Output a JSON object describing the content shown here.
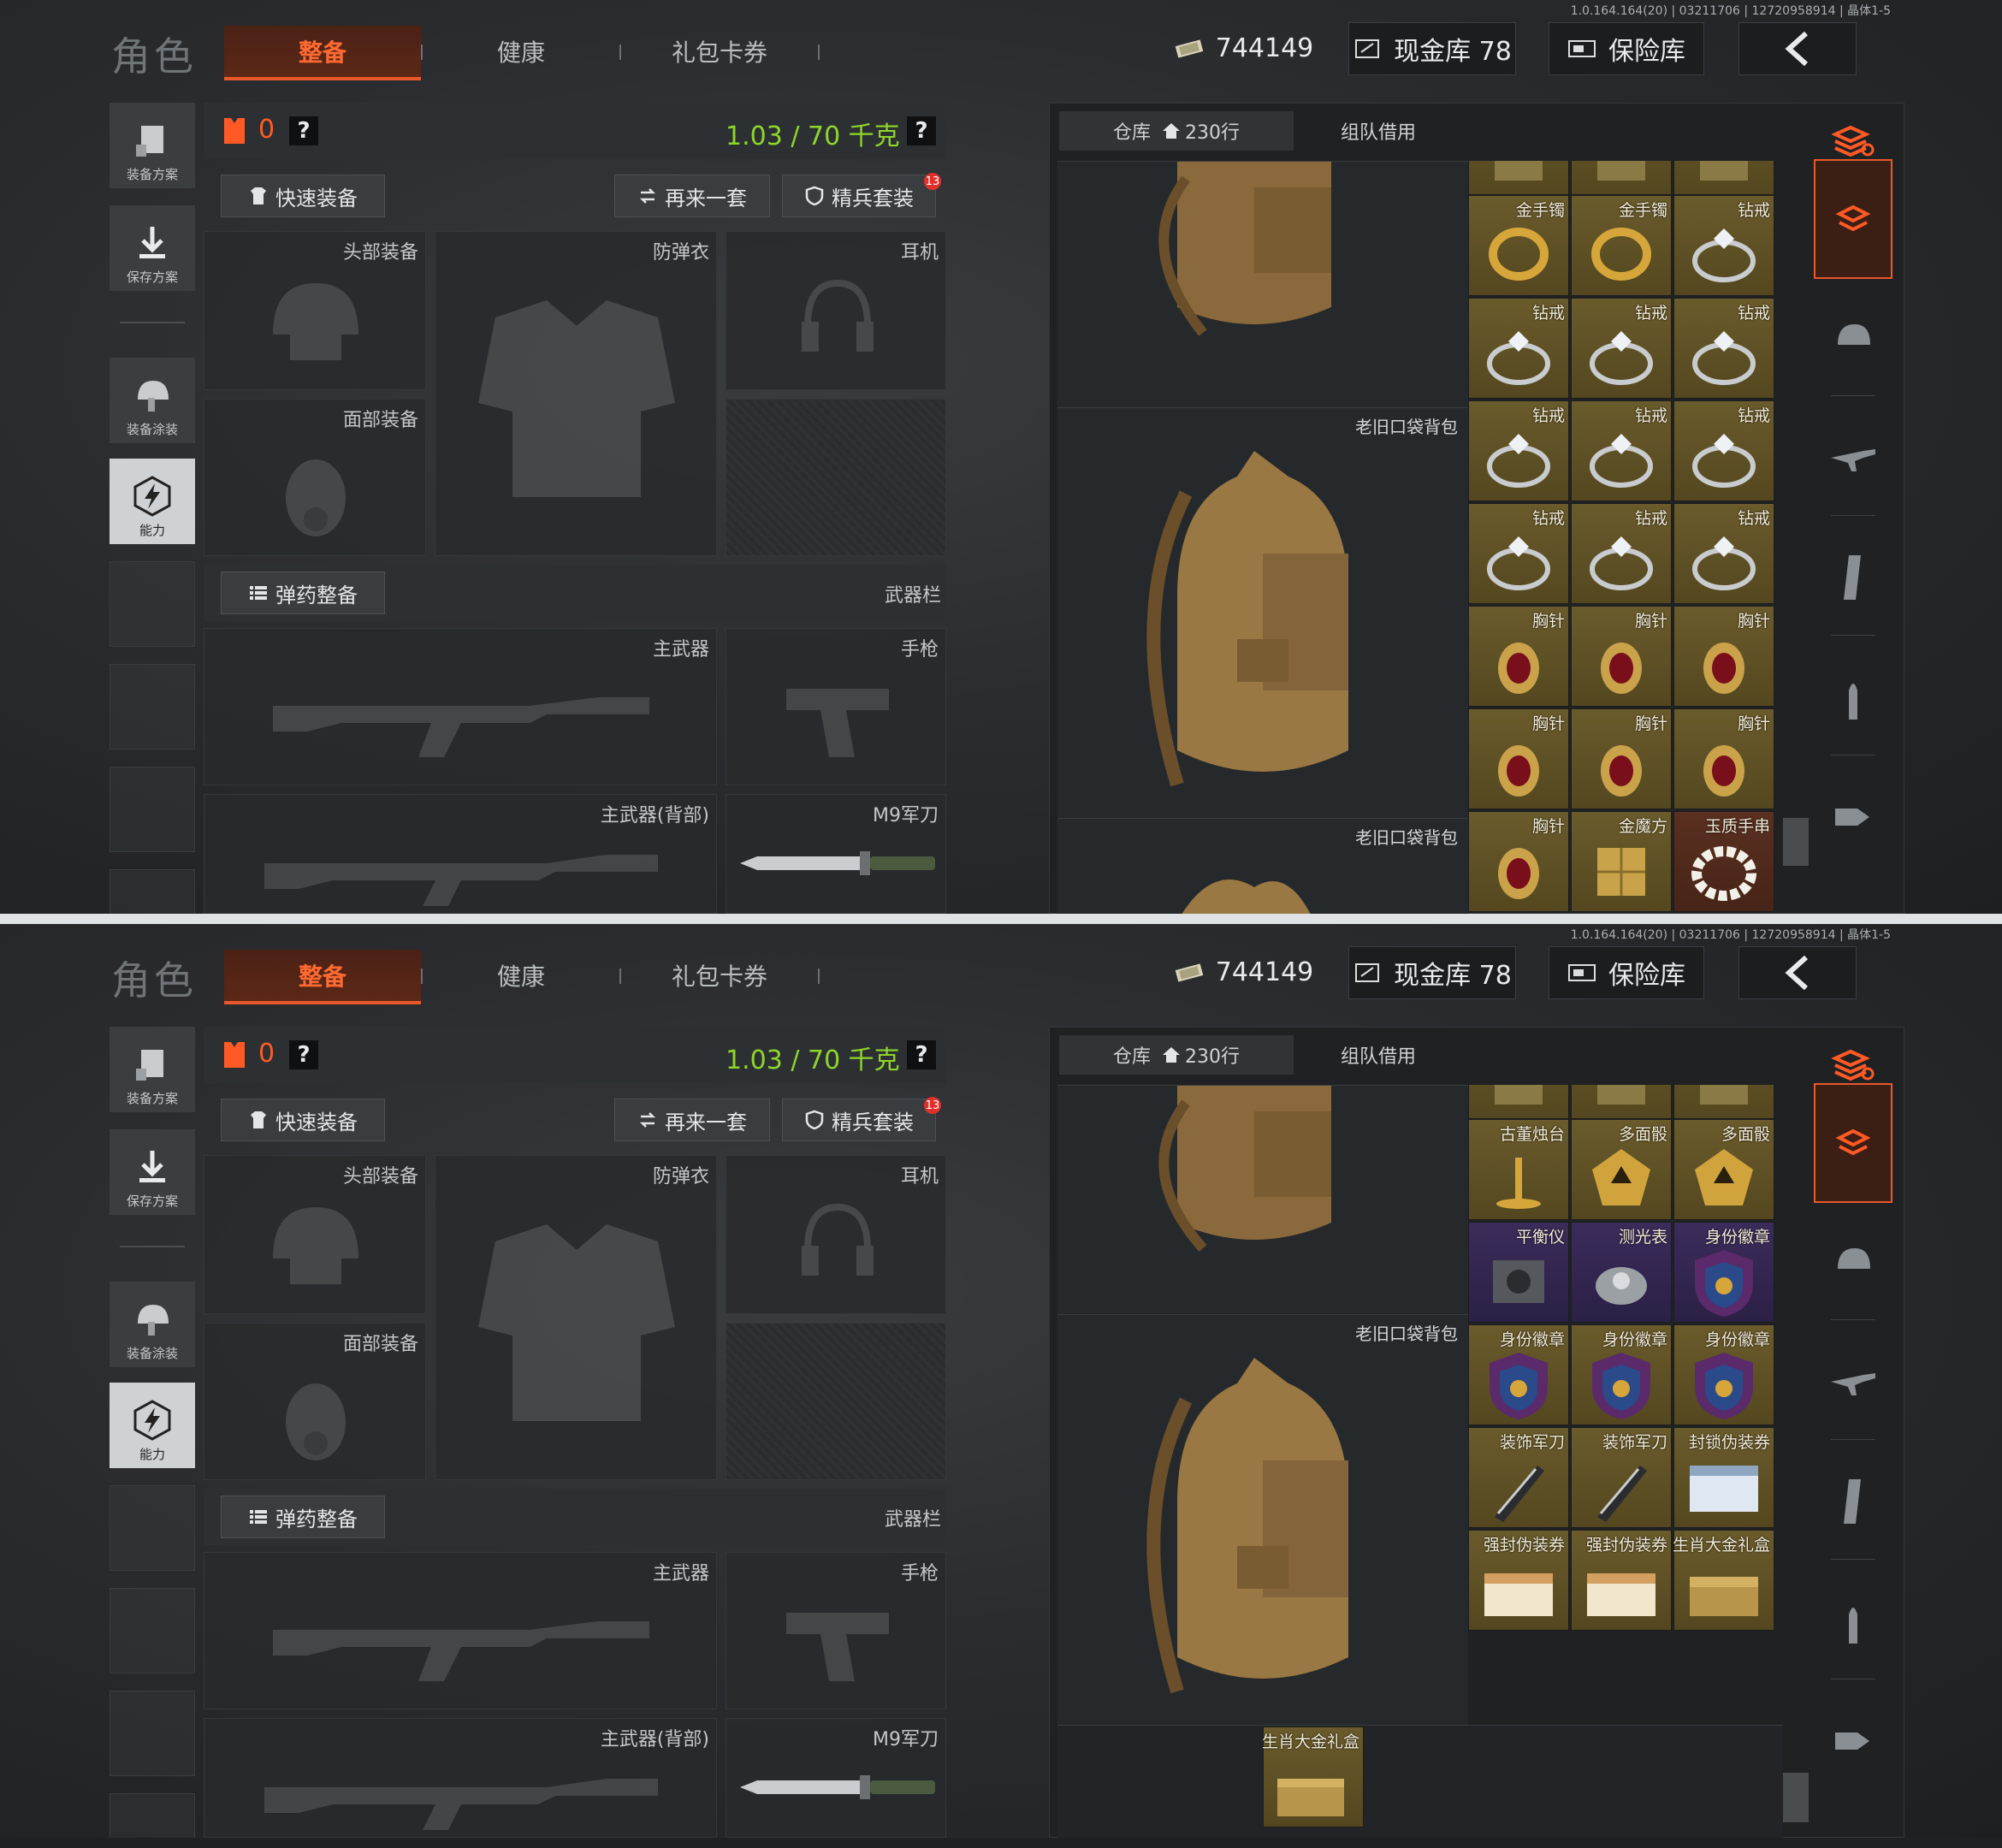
{
  "version": "1.0.164.164(20) | 03211706 | 12720958914 | 晶体1-5",
  "header": {
    "title": "角色",
    "tabs": [
      "整备",
      "健康",
      "礼包卡券"
    ],
    "money": "744149",
    "cash_vault": "现金库 78",
    "safe_box": "保险库"
  },
  "left_nav": {
    "plan": "装备方案",
    "save": "保存方案",
    "paint": "装备涂装",
    "ability": "能力"
  },
  "gear": {
    "armor_count": "0",
    "help": "?",
    "weight": "1.03 / 70 千克",
    "quick_equip": "快速装备",
    "again": "再来一套",
    "elite": "精兵套装",
    "elite_badge": "13",
    "slots": {
      "head": "头部装备",
      "armor": "防弹衣",
      "earphone": "耳机",
      "face": "面部装备",
      "ammo": "弹药整备",
      "weapon_bar": "武器栏",
      "primary": "主武器",
      "pistol": "手枪",
      "primary_back": "主武器(背部)",
      "knife": "M9军刀"
    }
  },
  "warehouse": {
    "tab_store": "仓库",
    "rows": "230行",
    "tab_team": "组队借用",
    "bag_label": "老旧口袋背包",
    "top_items": [
      [
        "",
        "",
        ""
      ],
      [
        "金手镯",
        "金手镯",
        "钻戒"
      ],
      [
        "钻戒",
        "钻戒",
        "钻戒"
      ],
      [
        "钻戒",
        "钻戒",
        "钻戒"
      ],
      [
        "钻戒",
        "钻戒",
        "钻戒"
      ],
      [
        "胸针",
        "胸针",
        "胸针"
      ],
      [
        "胸针",
        "胸针",
        "胸针"
      ],
      [
        "胸针",
        "金魔方",
        "玉质手串"
      ]
    ],
    "bottom_items": [
      [
        "",
        "",
        ""
      ],
      [
        "古董烛台",
        "多面骰",
        "多面骰"
      ],
      [
        "平衡仪",
        "测光表",
        "身份徽章"
      ],
      [
        "身份徽章",
        "身份徽章",
        "身份徽章"
      ],
      [
        "装饰军刀",
        "装饰军刀",
        "封锁伪装券"
      ],
      [
        "强封伪装券",
        "强封伪装券",
        "生肖大金礼盒"
      ]
    ],
    "bottom_extra": "生肖大金礼盒"
  },
  "colors": {
    "accent": "#e8582b",
    "weight_green": "#8fd62a",
    "item_gold": "#6a5b2c",
    "item_purple": "#3b2c5a"
  }
}
